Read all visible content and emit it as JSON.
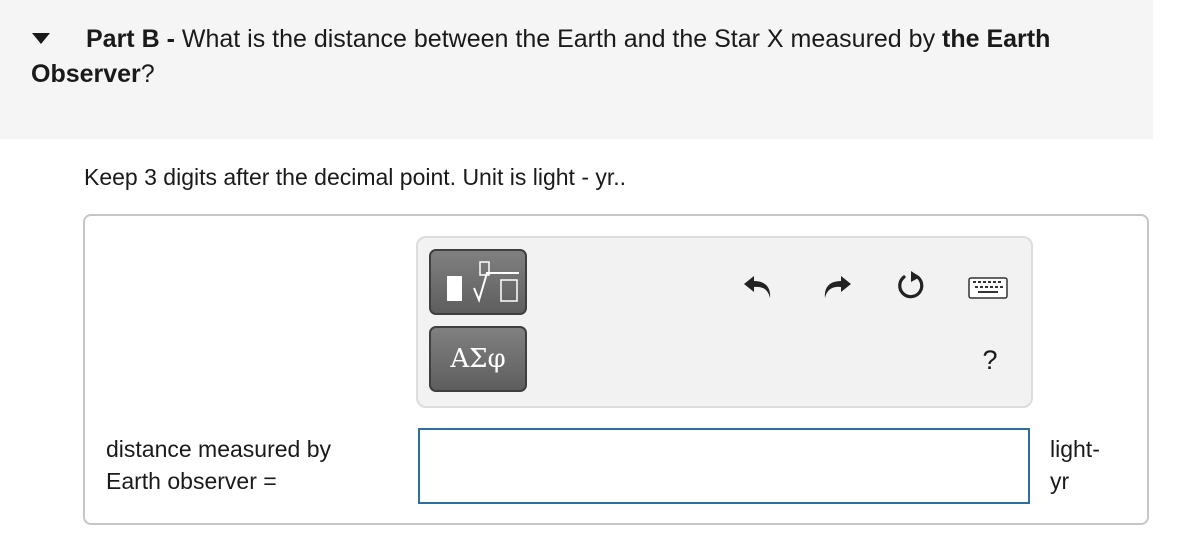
{
  "part": {
    "label": "Part B -",
    "question_prefix": " What is the distance between the Earth and the Star X measured by ",
    "question_bold": "the Earth Observer",
    "question_suffix": "?"
  },
  "instructions": "Keep 3 digits after the decimal point. Unit is light - yr..",
  "toolbar": {
    "symbols_label": "ΑΣφ",
    "help_label": "?",
    "icons": {
      "templates": "templates-icon",
      "undo": "undo-icon",
      "redo": "redo-icon",
      "reset": "reset-icon",
      "keyboard": "keyboard-icon"
    }
  },
  "answer": {
    "label_line1": "distance measured by",
    "label_line2": "Earth observer =",
    "value": "",
    "unit_line1": "light-",
    "unit_line2": "yr"
  },
  "colors": {
    "header_bg": "#f5f5f5",
    "input_border": "#2c6fa0",
    "button_bg": "#6e6e6e"
  }
}
